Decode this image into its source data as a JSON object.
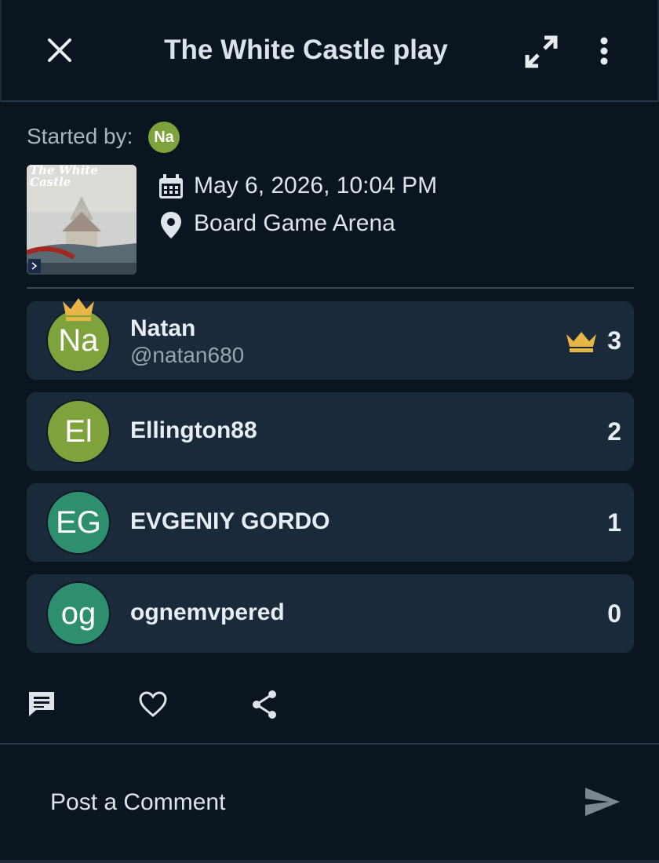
{
  "header": {
    "title": "The White Castle play",
    "close_icon": "close-icon",
    "expand_icon": "expand-icon",
    "more_icon": "more-vertical-icon"
  },
  "play": {
    "started_by_label": "Started by:",
    "starter_initials": "Na",
    "game_thumbnail_title": "The White Castle",
    "date": "May 6, 2026, 10:04 PM",
    "location": "Board Game Arena"
  },
  "players": [
    {
      "initials": "Na",
      "name": "Natan",
      "handle": "@natan680",
      "score": "3",
      "winner": true,
      "color": "#7ea33c"
    },
    {
      "initials": "El",
      "name": "Ellington88",
      "handle": "",
      "score": "2",
      "winner": false,
      "color": "#7ea33c"
    },
    {
      "initials": "EG",
      "name": "EVGENIY GORDO",
      "handle": "",
      "score": "1",
      "winner": false,
      "color": "#2e8f6e"
    },
    {
      "initials": "og",
      "name": "ognemvpered",
      "handle": "",
      "score": "0",
      "winner": false,
      "color": "#2e8f6e"
    }
  ],
  "actions": {
    "comment_icon": "comment-icon",
    "like_icon": "heart-icon",
    "share_icon": "share-icon"
  },
  "comment": {
    "placeholder": "Post a Comment",
    "send_icon": "send-icon"
  },
  "colors": {
    "background": "#0b1520",
    "card": "#1b2a3b",
    "crown": "#e8b547",
    "avatar_green": "#7ea33c",
    "avatar_teal": "#2e8f6e"
  }
}
